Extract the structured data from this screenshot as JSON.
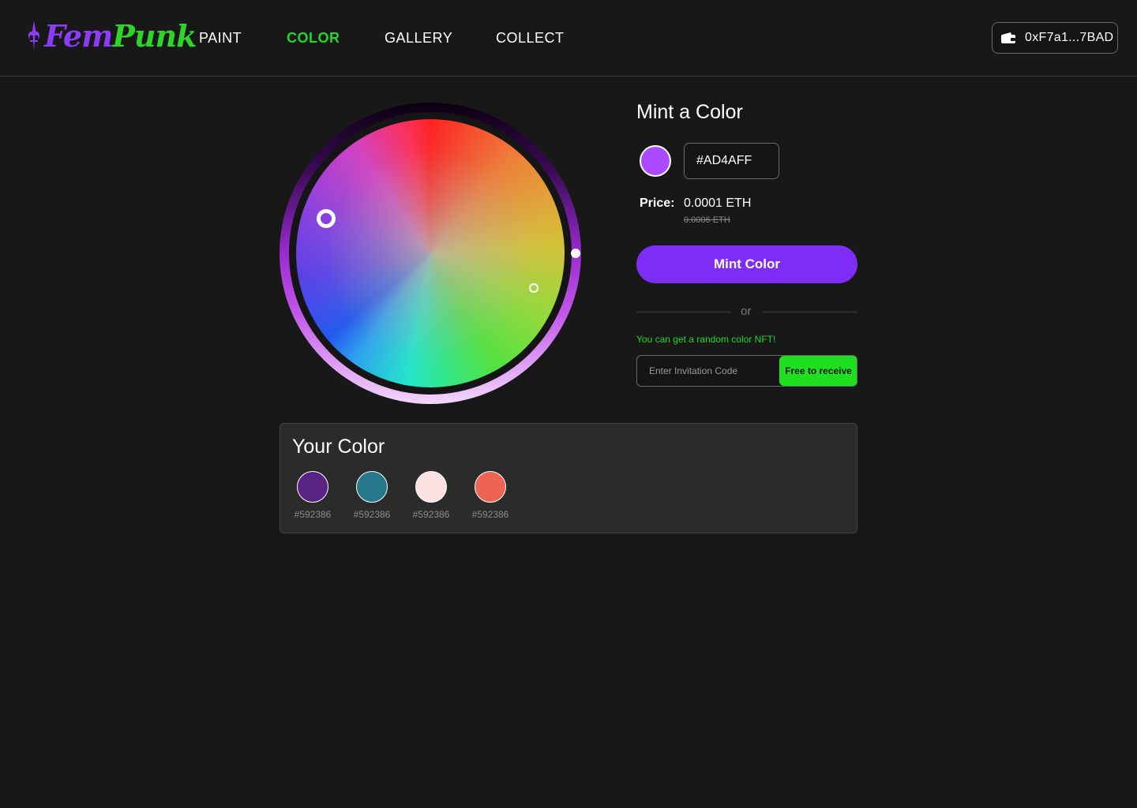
{
  "header": {
    "logo": {
      "part1": "Fem",
      "part2": "Punk"
    },
    "nav": [
      {
        "label": "PAINT",
        "active": false
      },
      {
        "label": "COLOR",
        "active": true
      },
      {
        "label": "GALLERY",
        "active": false
      },
      {
        "label": "COLLECT",
        "active": false
      }
    ],
    "wallet": {
      "icon": "wallet-icon",
      "address": "0xF7a1...7BAD"
    }
  },
  "mint": {
    "title": "Mint a Color",
    "selected_color": "#AD4AFF",
    "hex_value": "#AD4AFF",
    "price_label": "Price:",
    "price": "0.0001 ETH",
    "original_price": "0.0006 ETH",
    "mint_button": "Mint Color",
    "divider_text": "or",
    "random_text": "You can get a random color NFT!",
    "invite_placeholder": "Enter Invitation Code",
    "free_button": "Free to receive"
  },
  "your_colors": {
    "title": "Your Color",
    "items": [
      {
        "color": "#592386",
        "hex": "#592386"
      },
      {
        "color": "#25788A",
        "hex": "#592386"
      },
      {
        "color": "#FCE1E1",
        "hex": "#592386"
      },
      {
        "color": "#EE6452",
        "hex": "#592386"
      }
    ]
  },
  "colors": {
    "background": "#181818",
    "accent_purple": "#7D2DF5",
    "accent_green": "#22D62A"
  }
}
